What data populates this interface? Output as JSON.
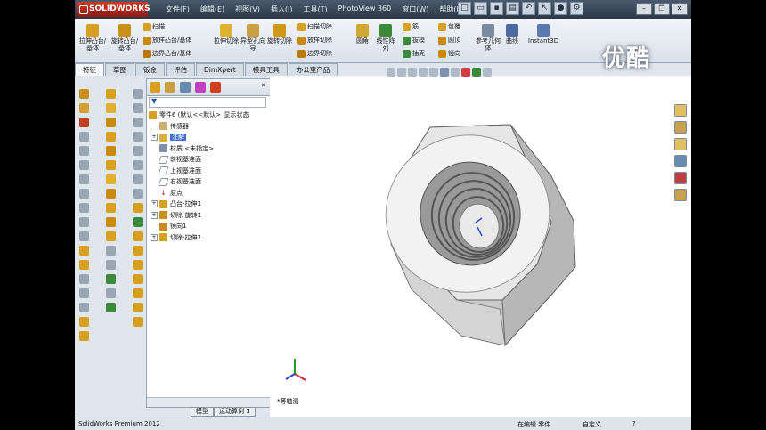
{
  "app": {
    "brand": "SOLIDWORKS",
    "watermark": "优酷"
  },
  "menu": [
    "文件(F)",
    "编辑(E)",
    "视图(V)",
    "插入(I)",
    "工具(T)",
    "PhotoView 360",
    "窗口(W)",
    "帮助(H)"
  ],
  "ribbon": {
    "big": [
      "拉伸凸台/基体",
      "旋转凸台/基体",
      "拉伸切除",
      "异型孔向导",
      "旋转切除",
      "圆角",
      "线性阵列",
      "参考几何体",
      "曲线",
      "Instant3D"
    ],
    "small": [
      "扫描",
      "放样凸台/基体",
      "边界凸台/基体",
      "扫描切除",
      "放样切除",
      "边界切除",
      "筋",
      "拔模",
      "抽壳",
      "包覆",
      "圆顶",
      "镜向"
    ]
  },
  "tabs": [
    "特征",
    "草图",
    "钣金",
    "评估",
    "DimXpert",
    "模具工具",
    "办公室产品"
  ],
  "tree": {
    "root": "零件6 (默认<<默认>_显示状态",
    "items": [
      {
        "label": "传感器",
        "expand": ""
      },
      {
        "label": "注解",
        "expand": "+",
        "selected": true
      },
      {
        "label": "材质 <未指定>",
        "expand": ""
      },
      {
        "label": "前视基准面",
        "expand": ""
      },
      {
        "label": "上视基准面",
        "expand": ""
      },
      {
        "label": "右视基准面",
        "expand": ""
      },
      {
        "label": "原点",
        "expand": ""
      },
      {
        "label": "凸台-拉伸1",
        "expand": "+"
      },
      {
        "label": "切除-旋转1",
        "expand": "+"
      },
      {
        "label": "镜向1",
        "expand": ""
      },
      {
        "label": "切除-拉伸1",
        "expand": "+"
      }
    ]
  },
  "bottom_tabs": [
    "模型",
    "运动算例 1"
  ],
  "view": {
    "orientation": "*等轴测"
  },
  "status": {
    "left": "SolidWorks Premium 2012",
    "edit": "在编辑 零件",
    "custom": "自定义",
    "help": "?"
  },
  "colors": {
    "accent_red": "#c8261b",
    "selection_blue": "#3d6fd0",
    "triad_x": "#d03030",
    "triad_y": "#2a9a2a",
    "triad_z": "#2a4ad0"
  }
}
